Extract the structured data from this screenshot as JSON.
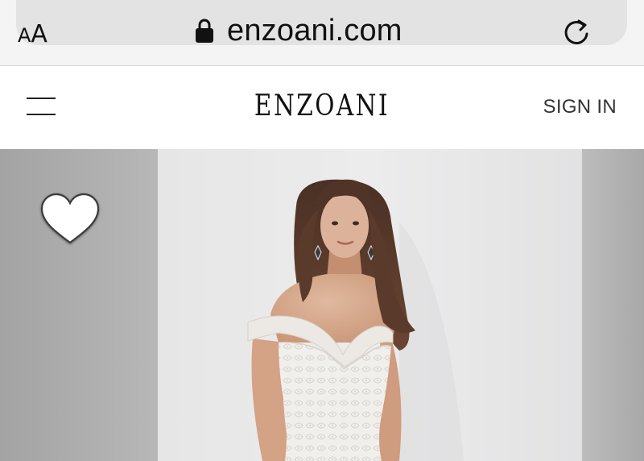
{
  "browser": {
    "text_size_small": "A",
    "text_size_large": "A",
    "url": "enzoani.com",
    "lock_icon": "lock-icon",
    "reload_icon": "reload-icon"
  },
  "header": {
    "menu_icon": "hamburger-menu-icon",
    "brand": "ENZOANI",
    "sign_in_label": "SIGN IN"
  },
  "product": {
    "wishlist_icon": "heart-icon"
  },
  "colors": {
    "chrome_bg": "#f4f4f4",
    "address_pill": "#e3e3e3",
    "text": "#111111",
    "gallery_bg": "#a9a8a9"
  }
}
